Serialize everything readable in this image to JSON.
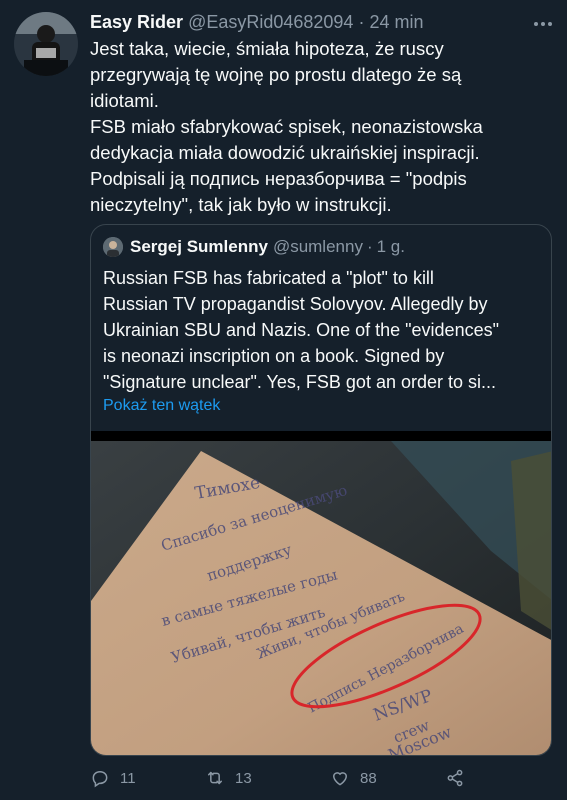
{
  "tweet": {
    "author_name": "Easy Rider",
    "author_handle": "@EasyRid04682094",
    "separator": "·",
    "time": "24 min",
    "text": "Jest taka, wiecie, śmiała hipoteza, że ruscy\nprzegrywają tę wojnę po prostu dlatego że są\nidiotami.\nFSB miało sfabrykować spisek, neonazistowska\ndedykacja miała dowodzić ukraińskiej inspiracji.\nPodpisali ją подпись неразборчива = \"podpis\nnieczytelny\", tak jak było w instrukcji."
  },
  "quote": {
    "author_name": "Sergej Sumlenny",
    "author_handle": "@sumlenny",
    "separator": "·",
    "time": "1 g.",
    "text": "Russian FSB has fabricated a \"plot\" to kill\nRussian TV propagandist Solovyov. Allegedly by\nUkrainian SBU and Nazis. One of the \"evidences\"\nis neonazi inscription on a book. Signed by\n\"Signature unclear\". Yes, FSB got an order to si...",
    "show_thread": "Pokaż ten wątek",
    "image": {
      "handwriting": [
        "Тимохе",
        "Спасибо за неоценимую",
        "поддержку",
        "в самые тяжелые годы",
        "Убивай, чтобы жить",
        "Живи, чтобы убивать",
        "Подпись Неразборчива",
        "NS/WP",
        "crew",
        "Moscow"
      ]
    }
  },
  "actions": {
    "reply_count": "11",
    "retweet_count": "13",
    "like_count": "88"
  },
  "colors": {
    "background": "#15202b",
    "text": "#f7f9f9",
    "secondary": "#8b98a5",
    "link": "#1d9bf0",
    "border": "#38444d"
  }
}
